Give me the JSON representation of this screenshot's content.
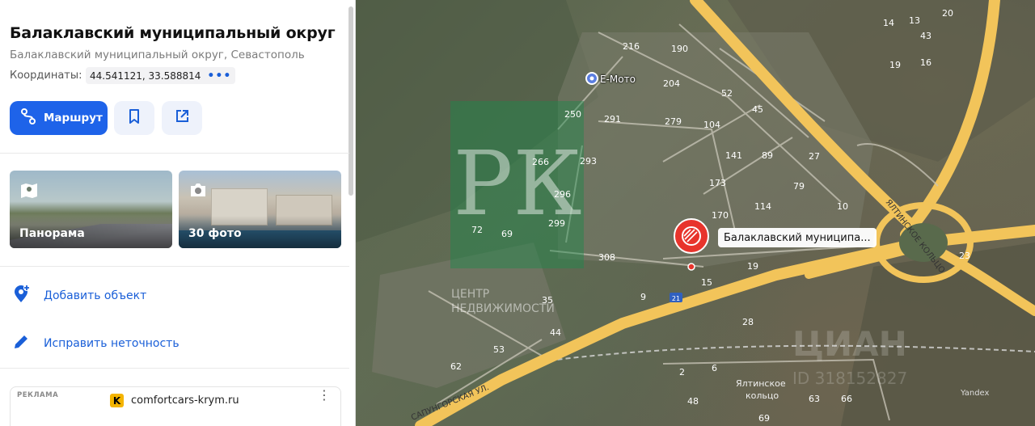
{
  "place": {
    "title": "Балаклавский муниципальный округ",
    "subtitle": "Балаклавский муниципальный округ, Севастополь",
    "coords_label": "Координаты:",
    "coords_value": "44.541121, 33.588814"
  },
  "actions": {
    "route_label": "Маршрут",
    "add_object": "Добавить объект",
    "fix_error": "Исправить неточность"
  },
  "media": {
    "panorama_label": "Панорама",
    "photos_label": "30 фото"
  },
  "ad": {
    "label": "РЕКЛАМА",
    "logo_letter": "K",
    "site": "comfortcars-krym.ru"
  },
  "map": {
    "poi_label": "Балаклавский муниципа...",
    "business_label": "Е-Мото",
    "street_sapun": "САПУНГОРСКАЯ УЛ.",
    "street_yalta_ring": "ЯЛТИНСКОЕ КОЛЬЦО",
    "area_label_1": "Ялтинское",
    "area_label_2": "кольцо",
    "road_shield": "21",
    "watermark_letters": "РК",
    "watermark_text_1": "ЦЕНТР",
    "watermark_text_2": "НЕДВИЖИМОСТИ",
    "cian_watermark": "ЦИАН",
    "cian_id": "ID 318152827",
    "provider": "Yandex",
    "house_numbers": [
      "216",
      "190",
      "204",
      "250",
      "291",
      "279",
      "52",
      "45",
      "104",
      "141",
      "89",
      "27",
      "266",
      "293",
      "173",
      "79",
      "296",
      "114",
      "10",
      "170",
      "299",
      "72",
      "69",
      "308",
      "19",
      "23",
      "9",
      "15",
      "28",
      "35",
      "44",
      "53",
      "62",
      "2",
      "6",
      "48",
      "63",
      "66",
      "69",
      "14",
      "16",
      "19",
      "13",
      "43",
      "20"
    ]
  },
  "colors": {
    "accent": "#1e63e9",
    "poi_marker": "#e8342c",
    "road": "#f2c45a"
  }
}
